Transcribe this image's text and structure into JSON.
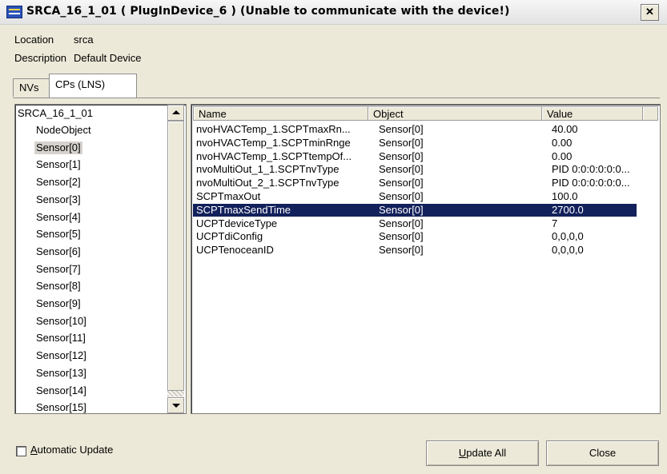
{
  "window": {
    "title": "SRCA_16_1_01 ( PlugInDevice_6 ) (Unable to communicate with the device!)",
    "close_glyph": "✕"
  },
  "info": {
    "location_label": "Location",
    "location_value": "srca",
    "description_label": "Description",
    "description_value": "Default Device"
  },
  "tabs": [
    "NVs",
    "CPs (LNS)"
  ],
  "active_tab": "CPs (LNS)",
  "tree": {
    "root": "SRCA_16_1_01",
    "items": [
      "NodeObject",
      "Sensor[0]",
      "Sensor[1]",
      "Sensor[2]",
      "Sensor[3]",
      "Sensor[4]",
      "Sensor[5]",
      "Sensor[6]",
      "Sensor[7]",
      "Sensor[8]",
      "Sensor[9]",
      "Sensor[10]",
      "Sensor[11]",
      "Sensor[12]",
      "Sensor[13]",
      "Sensor[14]",
      "Sensor[15]"
    ],
    "selected": "Sensor[0]"
  },
  "table": {
    "columns": [
      "Name",
      "Object",
      "Value"
    ],
    "rows": [
      [
        "nvoHVACTemp_1.SCPTmaxRn...",
        "Sensor[0]",
        "40.00"
      ],
      [
        "nvoHVACTemp_1.SCPTminRnge",
        "Sensor[0]",
        "0.00"
      ],
      [
        "nvoHVACTemp_1.SCPTtempOf...",
        "Sensor[0]",
        "0.00"
      ],
      [
        "nvoMultiOut_1_1.SCPTnvType",
        "Sensor[0]",
        "PID 0:0:0:0:0:0..."
      ],
      [
        "nvoMultiOut_2_1.SCPTnvType",
        "Sensor[0]",
        "PID 0:0:0:0:0:0..."
      ],
      [
        "SCPTmaxOut",
        "Sensor[0]",
        "100.0"
      ],
      [
        "SCPTmaxSendTime",
        "Sensor[0]",
        "2700.0"
      ],
      [
        "UCPTdeviceType",
        "Sensor[0]",
        "7"
      ],
      [
        "UCPTdiConfig",
        "Sensor[0]",
        "0,0,0,0"
      ],
      [
        "UCPTenoceanID",
        "Sensor[0]",
        "0,0,0,0"
      ]
    ],
    "selected_row": "SCPTmaxSendTime"
  },
  "footer": {
    "auto_update_label": "Automatic Update",
    "auto_update_checked": false,
    "update_all_label": "Update All",
    "close_label": "Close"
  },
  "colors": {
    "selection": "#12205b",
    "window_bg": "#ece9d8"
  }
}
